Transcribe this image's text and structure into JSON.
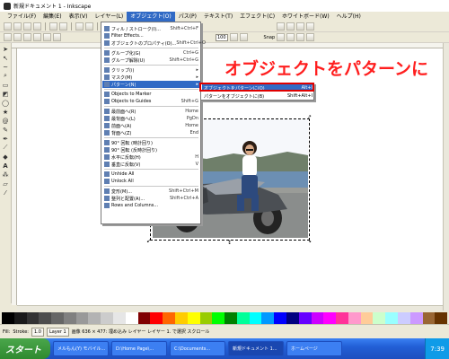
{
  "window": {
    "title": "新規ドキュメント 1 - Inkscape"
  },
  "menubar": {
    "items": [
      {
        "label": "ファイル(F)"
      },
      {
        "label": "編集(E)"
      },
      {
        "label": "表示(V)"
      },
      {
        "label": "レイヤー(L)"
      },
      {
        "label": "オブジェクト(O)"
      },
      {
        "label": "パス(P)"
      },
      {
        "label": "テキスト(T)"
      },
      {
        "label": "エフェクト(C)"
      },
      {
        "label": "ホワイトボード(W)"
      },
      {
        "label": "ヘルプ(H)"
      }
    ],
    "active_index": 4
  },
  "toolbar": {
    "zoom_value": "100",
    "snap_label": "Snap"
  },
  "object_menu": {
    "items": [
      {
        "label": "フィル / ストローク(I)...",
        "shortcut": "Shift+Ctrl+F"
      },
      {
        "label": "Filter Effects...",
        "shortcut": ""
      },
      {
        "label": "オブジェクトのプロパティ(O)...",
        "shortcut": "Shift+Ctrl+O"
      },
      {
        "label": "グループ化(G)",
        "shortcut": "Ctrl+G"
      },
      {
        "label": "グループ解除(U)",
        "shortcut": "Shift+Ctrl+G"
      },
      {
        "label": "クリップ(i)",
        "shortcut": "▸"
      },
      {
        "label": "マスク(M)",
        "shortcut": "▸"
      },
      {
        "label": "パターン(N)",
        "shortcut": "▸"
      },
      {
        "label": "Objects to Marker",
        "shortcut": ""
      },
      {
        "label": "Objects to Guides",
        "shortcut": "Shift+G"
      },
      {
        "label": "最前面へ(R)",
        "shortcut": "Home"
      },
      {
        "label": "最背面へ(L)",
        "shortcut": "PgDn"
      },
      {
        "label": "前面へ(A)",
        "shortcut": "Home"
      },
      {
        "label": "背面へ(Z)",
        "shortcut": "End"
      },
      {
        "label": "90° 回転 (時計回り)",
        "shortcut": ""
      },
      {
        "label": "90° 回転 (反時計回り)",
        "shortcut": ""
      },
      {
        "label": "水平に反転(H)",
        "shortcut": "H"
      },
      {
        "label": "垂直に反転(V)",
        "shortcut": "V"
      },
      {
        "label": "Unhide All",
        "shortcut": ""
      },
      {
        "label": "Unlock All",
        "shortcut": ""
      },
      {
        "label": "変形(M)...",
        "shortcut": "Shift+Ctrl+M"
      },
      {
        "label": "整列と配置(A)...",
        "shortcut": "Shift+Ctrl+A"
      },
      {
        "label": "Rows and Columns...",
        "shortcut": ""
      }
    ],
    "highlight_index": 7
  },
  "pattern_submenu": {
    "items": [
      {
        "label": "オブジェクトをパターンに(O)",
        "shortcut": "Alt+I"
      },
      {
        "label": "パターンをオブジェクトに(B)",
        "shortcut": "Shift+Alt+I"
      }
    ],
    "highlight_index": 0
  },
  "annotation": {
    "text": "オブジェクトをパターンに"
  },
  "palette": {
    "colors": [
      "#000000",
      "#1a1a1a",
      "#333333",
      "#4d4d4d",
      "#666666",
      "#808080",
      "#999999",
      "#b3b3b3",
      "#cccccc",
      "#e6e6e6",
      "#ffffff",
      "#800000",
      "#ff0000",
      "#ff6600",
      "#ffcc00",
      "#ffff00",
      "#99cc00",
      "#00ff00",
      "#008000",
      "#00ff99",
      "#00ffff",
      "#0099ff",
      "#0000ff",
      "#000080",
      "#6600ff",
      "#cc00ff",
      "#ff00ff",
      "#ff3399",
      "#ff99cc",
      "#ffcc99",
      "#ccffcc",
      "#99ffff",
      "#ccccff",
      "#cc99ff",
      "#996633",
      "#663300"
    ]
  },
  "statusbar": {
    "fill_label": "Fill:",
    "stroke_label": "Stroke:",
    "opacity": "1.0",
    "layer": "Layer 1",
    "message": "画像 636 × 477: 埋め込み レイヤー レイヤー 1. で選択 スクロール"
  },
  "taskbar": {
    "start_label": "スタート",
    "tasks": [
      {
        "label": "メルもん(Y) モバイル..."
      },
      {
        "label": "D:\\Home Page\\..."
      },
      {
        "label": "C:\\Documents..."
      },
      {
        "label": "新規ドキュメント 1..."
      },
      {
        "label": "ホームページ"
      }
    ],
    "active_index": 3,
    "clock": "7:39"
  }
}
